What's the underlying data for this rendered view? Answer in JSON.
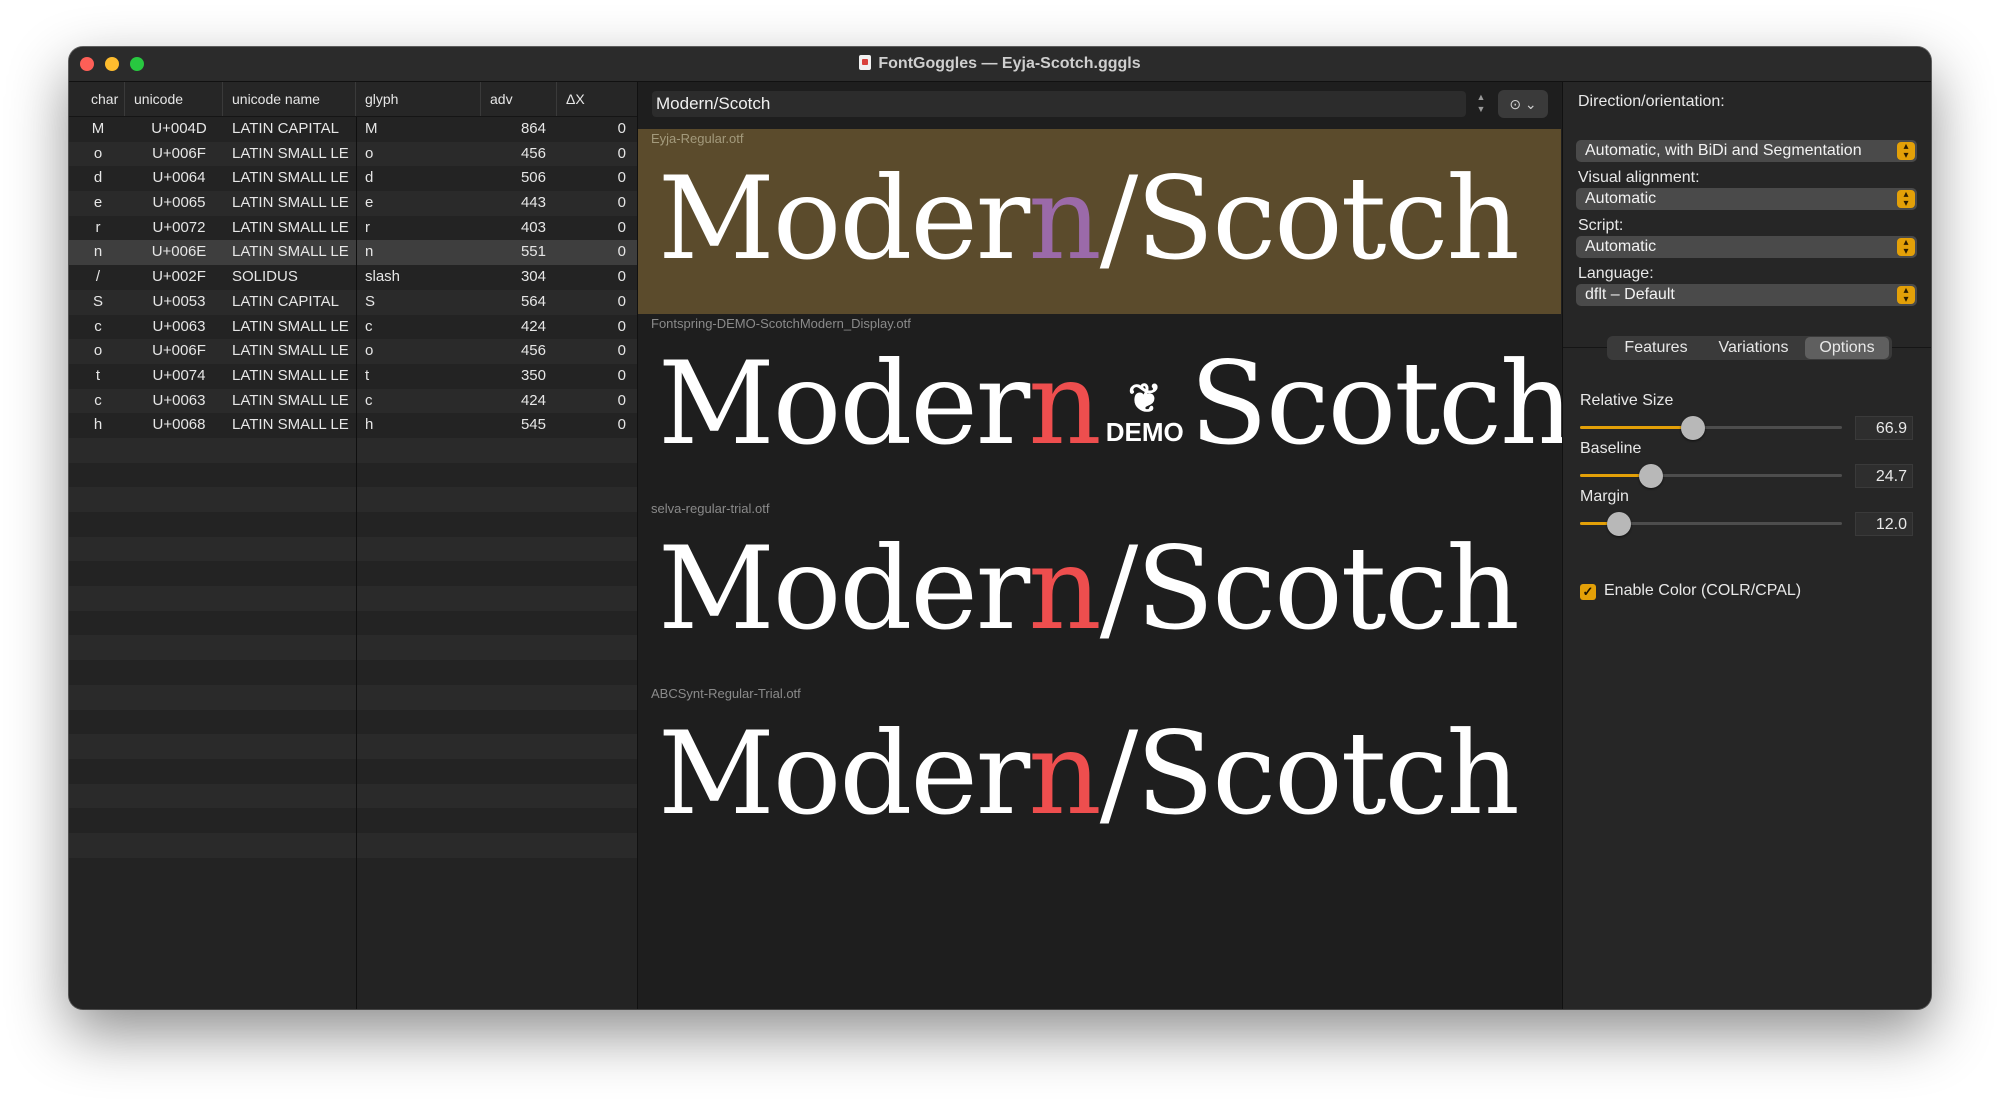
{
  "window": {
    "title": "FontGoggles — Eyja-Scotch.gggls",
    "doc_icon": "document-icon"
  },
  "glyph_table": {
    "columns": [
      "char",
      "unicode",
      "unicode name",
      "glyph",
      "adv",
      "ΔX"
    ],
    "rows": [
      {
        "char": "M",
        "unicode": "U+004D",
        "name": "LATIN CAPITAL",
        "glyph": "M",
        "adv": "864",
        "dx": "0"
      },
      {
        "char": "o",
        "unicode": "U+006F",
        "name": "LATIN SMALL LE",
        "glyph": "o",
        "adv": "456",
        "dx": "0"
      },
      {
        "char": "d",
        "unicode": "U+0064",
        "name": "LATIN SMALL LE",
        "glyph": "d",
        "adv": "506",
        "dx": "0"
      },
      {
        "char": "e",
        "unicode": "U+0065",
        "name": "LATIN SMALL LE",
        "glyph": "e",
        "adv": "443",
        "dx": "0"
      },
      {
        "char": "r",
        "unicode": "U+0072",
        "name": "LATIN SMALL LE",
        "glyph": "r",
        "adv": "403",
        "dx": "0"
      },
      {
        "char": "n",
        "unicode": "U+006E",
        "name": "LATIN SMALL LE",
        "glyph": "n",
        "adv": "551",
        "dx": "0"
      },
      {
        "char": "/",
        "unicode": "U+002F",
        "name": "SOLIDUS",
        "glyph": "slash",
        "adv": "304",
        "dx": "0"
      },
      {
        "char": "S",
        "unicode": "U+0053",
        "name": "LATIN CAPITAL",
        "glyph": "S",
        "adv": "564",
        "dx": "0"
      },
      {
        "char": "c",
        "unicode": "U+0063",
        "name": "LATIN SMALL LE",
        "glyph": "c",
        "adv": "424",
        "dx": "0"
      },
      {
        "char": "o",
        "unicode": "U+006F",
        "name": "LATIN SMALL LE",
        "glyph": "o",
        "adv": "456",
        "dx": "0"
      },
      {
        "char": "t",
        "unicode": "U+0074",
        "name": "LATIN SMALL LE",
        "glyph": "t",
        "adv": "350",
        "dx": "0"
      },
      {
        "char": "c",
        "unicode": "U+0063",
        "name": "LATIN SMALL LE",
        "glyph": "c",
        "adv": "424",
        "dx": "0"
      },
      {
        "char": "h",
        "unicode": "U+0068",
        "name": "LATIN SMALL LE",
        "glyph": "h",
        "adv": "545",
        "dx": "0"
      }
    ],
    "selected_row": 5
  },
  "preview": {
    "text": "Modern/Scotch",
    "action_icon": "ellipsis-circle-icon",
    "fonts": [
      {
        "file": "Eyja-Regular.otf",
        "before": "Moder",
        "highlight": "n",
        "after": "/Scotch",
        "selected": true
      },
      {
        "file": "Fontspring-DEMO-ScotchModern_Display.otf",
        "before": "Moder",
        "highlight": "n",
        "demo": "DEMO",
        "after": "Scotch",
        "selected": false
      },
      {
        "file": "selva-regular-trial.otf",
        "before": "Moder",
        "highlight": "n",
        "after": "/Scotch",
        "selected": false
      },
      {
        "file": "ABCSynt-Regular-Trial.otf",
        "before": "Moder",
        "highlight": "n",
        "after": "/Scotch",
        "selected": false
      }
    ]
  },
  "options": {
    "direction_label": "Direction/orientation:",
    "direction_value": "Automatic, with BiDi and Segmentation",
    "alignment_label": "Visual alignment:",
    "alignment_value": "Automatic",
    "script_label": "Script:",
    "script_value": "Automatic",
    "language_label": "Language:",
    "language_value": "dflt – Default",
    "tabs": [
      "Features",
      "Variations",
      "Options"
    ],
    "active_tab": 2,
    "sliders": [
      {
        "label": "Relative Size",
        "value": "66.9",
        "fraction": 0.43
      },
      {
        "label": "Baseline",
        "value": "24.7",
        "fraction": 0.27
      },
      {
        "label": "Margin",
        "value": "12.0",
        "fraction": 0.15
      }
    ],
    "color_checkbox_label": "Enable Color (COLR/CPAL)",
    "color_checkbox_checked": true
  },
  "colors": {
    "accent": "#e3a008",
    "selected_preview_bg": "#5b4b2c",
    "highlight_glyph": "#ee4e4e",
    "selected_highlight_glyph": "#9b6aa9"
  }
}
